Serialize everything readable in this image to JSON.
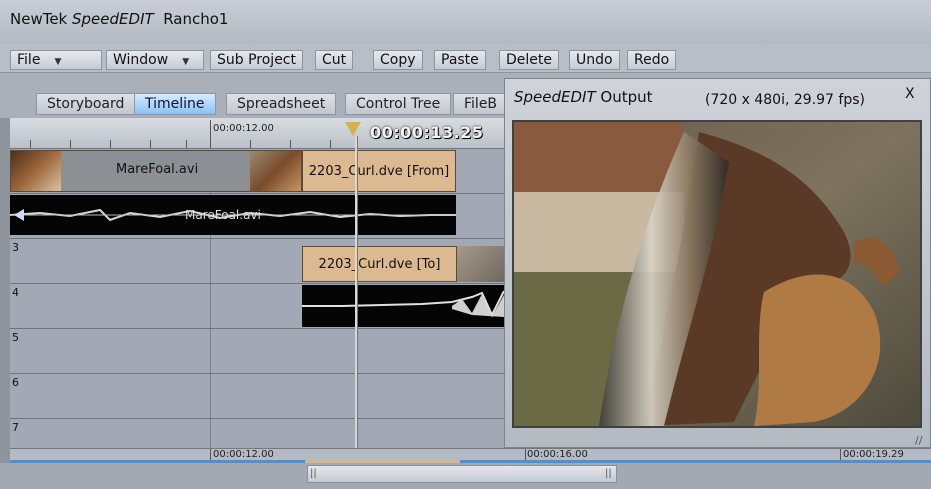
{
  "title": {
    "app": "NewTek ",
    "product": "SpeedEDIT",
    "project": "  Rancho1"
  },
  "menu": {
    "file": "File",
    "window": "Window",
    "sub_project": "Sub Project",
    "cut": "Cut",
    "copy": "Copy",
    "paste": "Paste",
    "delete": "Delete",
    "undo": "Undo",
    "redo": "Redo"
  },
  "tabs": {
    "storyboard": "Storyboard",
    "timeline": "Timeline",
    "spreadsheet": "Spreadsheet",
    "control_tree": "Control Tree",
    "filebin": "FileB"
  },
  "ruler": {
    "mark_time": "00:00:12.00",
    "current_time": "00:00:13.25"
  },
  "tracks": {
    "t3": "3",
    "t4": "4",
    "t5": "5",
    "t6": "6",
    "t7": "7"
  },
  "clips": {
    "mare_video": "MareFoal.avi",
    "curl_from": "2203_Curl.dve  [From]",
    "mare_audio": "MareFoal.avi",
    "curl_to": "2203_Curl.dve  [To]"
  },
  "preview": {
    "title_italic": "SpeedEDIT",
    "title_rest": " Output",
    "resolution": "(720 x 480i, 29.97 fps)",
    "close": "X"
  },
  "bottom": {
    "time1": "00:00:12.00",
    "time2": "00:00:16.00",
    "time3": "00:00:19.29"
  },
  "colors": {
    "active_tab": "#8cc1f2",
    "clip_tan": "#ddb992",
    "playhead": "#d4b24c",
    "scroll_blue": "#4f8fd6"
  }
}
